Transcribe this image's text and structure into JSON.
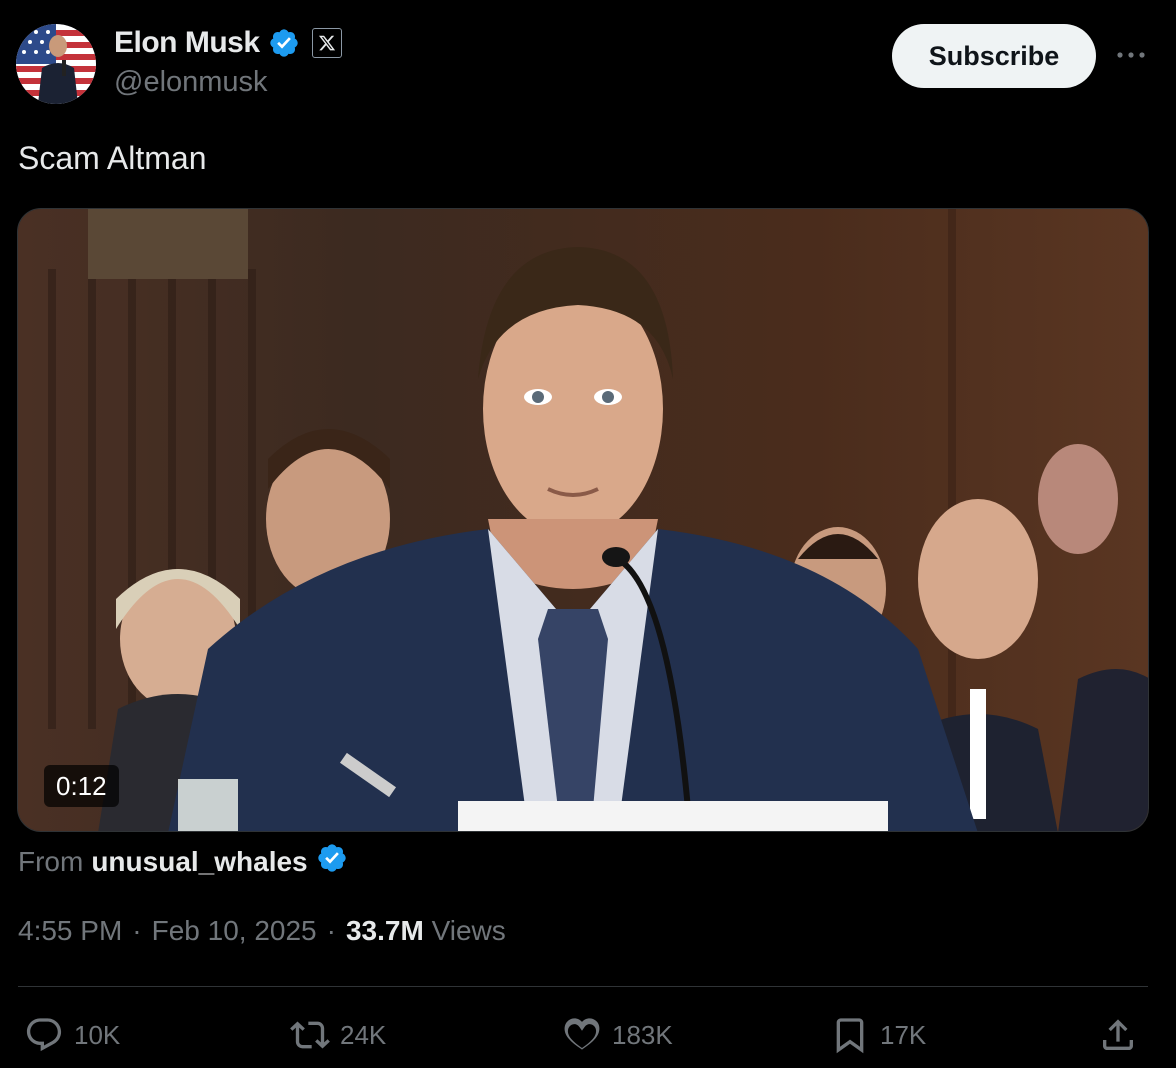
{
  "author": {
    "name": "Elon Musk",
    "handle": "@elonmusk",
    "verified_icon": "verified-badge-icon",
    "affiliate_icon": "x-logo-icon"
  },
  "header": {
    "subscribe_label": "Subscribe",
    "more_icon": "more-dots-icon"
  },
  "tweet": {
    "text": "Scam Altman"
  },
  "media": {
    "type": "video",
    "description_icon": "video-thumbnail",
    "duration": "0:12"
  },
  "source": {
    "prefix": "From",
    "account": "unusual_whales"
  },
  "meta": {
    "time": "4:55 PM",
    "separator": "·",
    "date": "Feb 10, 2025",
    "views_count": "33.7M",
    "views_label": "Views"
  },
  "actions": {
    "reply": {
      "icon": "reply-icon",
      "count": "10K"
    },
    "repost": {
      "icon": "repost-icon",
      "count": "24K"
    },
    "like": {
      "icon": "heart-icon",
      "count": "183K"
    },
    "bookmark": {
      "icon": "bookmark-icon",
      "count": "17K"
    },
    "share": {
      "icon": "share-icon"
    }
  },
  "colors": {
    "background": "#000000",
    "text_primary": "#e7e9ea",
    "text_secondary": "#71767b",
    "verified_blue": "#1d9bf0",
    "button_bg": "#eff3f4"
  }
}
